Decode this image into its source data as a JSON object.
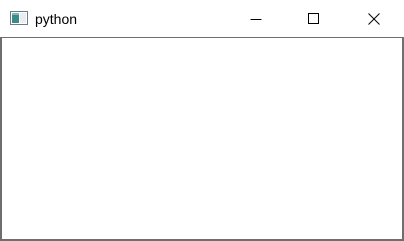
{
  "window": {
    "title": "python",
    "app_icon": "python-app-icon",
    "controls": {
      "minimize": "minimize-icon",
      "maximize": "maximize-icon",
      "close": "close-icon"
    }
  },
  "colors": {
    "titlebar_bg": "#ffffff",
    "client_bg": "#ffffff",
    "border": "#6e6e6e"
  }
}
